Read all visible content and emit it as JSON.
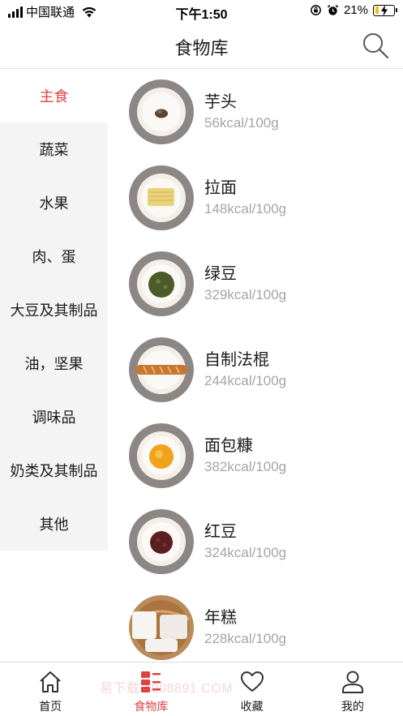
{
  "status_bar": {
    "carrier": "中国联通",
    "time": "下午1:50",
    "battery": "21%"
  },
  "nav": {
    "title": "食物库",
    "search_icon": "search-icon"
  },
  "sidebar": {
    "items": [
      {
        "label": "主食",
        "active": true
      },
      {
        "label": "蔬菜",
        "active": false
      },
      {
        "label": "水果",
        "active": false
      },
      {
        "label": "肉、蛋",
        "active": false
      },
      {
        "label": "大豆及其制品",
        "active": false
      },
      {
        "label": "油，坚果",
        "active": false
      },
      {
        "label": "调味品",
        "active": false
      },
      {
        "label": "奶类及其制品",
        "active": false
      },
      {
        "label": "其他",
        "active": false
      }
    ]
  },
  "foods": [
    {
      "name": "芋头",
      "kcal": "56kcal/100g"
    },
    {
      "name": "拉面",
      "kcal": "148kcal/100g"
    },
    {
      "name": "绿豆",
      "kcal": "329kcal/100g"
    },
    {
      "name": "自制法棍",
      "kcal": "244kcal/100g"
    },
    {
      "name": "面包糠",
      "kcal": "382kcal/100g"
    },
    {
      "name": "红豆",
      "kcal": "324kcal/100g"
    },
    {
      "name": "年糕",
      "kcal": "228kcal/100g"
    }
  ],
  "tabs": [
    {
      "label": "首页",
      "icon": "home-icon",
      "active": false
    },
    {
      "label": "食物库",
      "icon": "food-library-icon",
      "active": true
    },
    {
      "label": "收藏",
      "icon": "heart-icon",
      "active": false
    },
    {
      "label": "我的",
      "icon": "user-icon",
      "active": false
    }
  ],
  "colors": {
    "accent": "#e0423f",
    "muted_text": "#a5a5a5",
    "sidebar_bg": "#f4f4f4"
  },
  "watermark": "易下载 4008891    COM"
}
